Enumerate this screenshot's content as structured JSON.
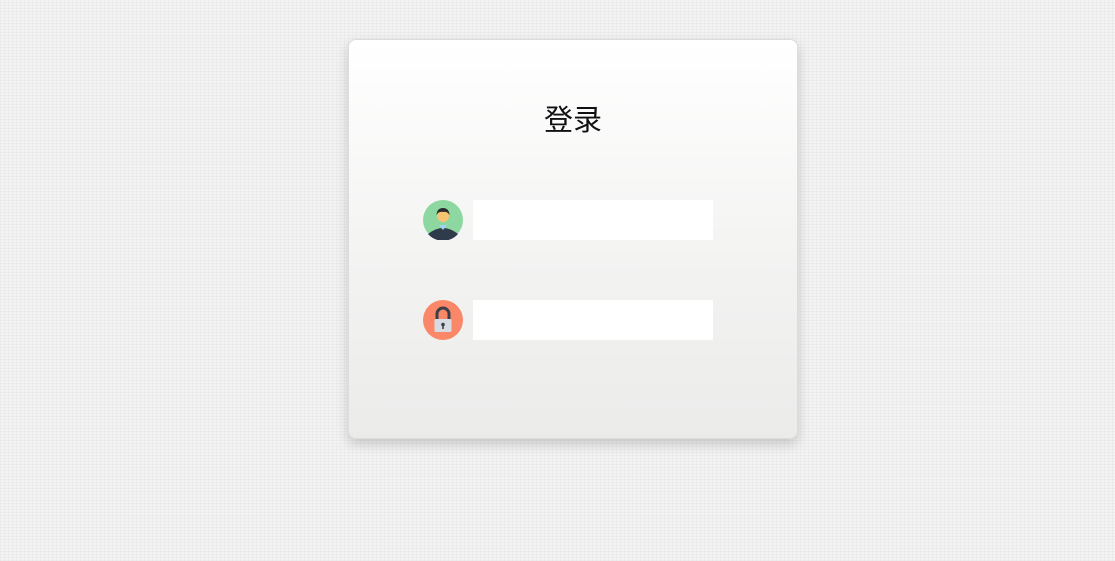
{
  "login": {
    "title": "登录",
    "username": {
      "icon": "user-avatar-icon",
      "value": "",
      "placeholder": ""
    },
    "password": {
      "icon": "lock-icon",
      "value": "",
      "placeholder": ""
    }
  },
  "colors": {
    "user_icon_bg": "#8dd7a0",
    "lock_icon_bg": "#fb8769"
  }
}
